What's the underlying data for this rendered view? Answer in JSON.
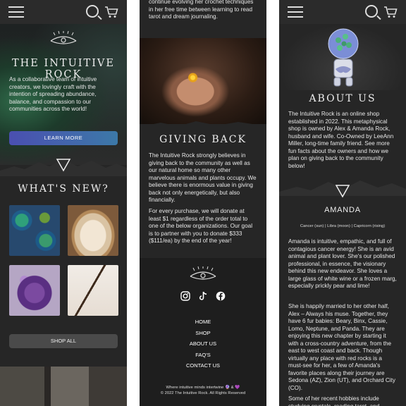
{
  "screen1": {
    "brand_title": "THE INTUITIVE ROCK",
    "intro": "As a collaborative team of intuitive creators, we lovingly craft with the intention of spreading abundance, balance, and compassion to our communities across the world!",
    "learn_more": "LEARN MORE",
    "whats_new_title": "WHAT'S NEW?",
    "shop_all": "SHOP ALL"
  },
  "screen2": {
    "top_text": "continue evolving her crochet techniques in her free time between learning to read tarot and dream journaling.",
    "giving_back_title": "GIVING BACK",
    "giving_back_p1": "The Intuitive Rock strongly believes in giving back to the community as well as our natural home so many other marvelous animals and plants occupy. We believe there is enormous value in giving back not only energetically, but also financially.",
    "giving_back_p2": "For every purchase, we will donate at least $1 regardless of the order total to one of the below organizations. Our goal is to partner with you to donate $333 ($111/ea) by the end of the year!",
    "footer_links": [
      "HOME",
      "SHOP",
      "ABOUT US",
      "FAQ'S",
      "CONTACT US"
    ],
    "tagline": "Where intuitive minds intertwine 🔮 & 💜",
    "copyright": "© 2022 The Intuitive Rock. All Rights Reserved"
  },
  "screen3": {
    "about_title": "ABOUT US",
    "about_text": "The Intuitive Rock is an online shop established in 2022. This metaphysical shop is owned by Alex & Amanda Rock, husband and wife. Co-Owned by LeeAnn Miller, long-time family friend. See more fun facts about the owners and how we plan on giving back to the community below!",
    "person_name": "AMANDA",
    "signs": "Cancer (sun) | Libra (moon) | Capricorn (rising)",
    "bio_p1": "Amanda is intuitive, empathic, and full of contagious cancer energy! She is an avid animal and plant lover. She's our polished professional, in essence, the visionary behind this new endeavor. She loves a large glass of white wine or a frozen marg, especially prickly pear and lime!",
    "bio_p2": "She is happily married to her other half, Alex – Always his muse. Together, they have 6 fur babies: Beary, Binx, Cassie, Lomo, Neptune, and Panda. They are enjoying this new chapter by starting it with a cross-country adventure, from the east to west coast and back. Though virtually any place with red rocks is a must-see for her, a few of Amanda's favorite places along their journey are Sedona (AZ), Zion (UT), and Orchard City (CO).",
    "bio_p3": "Some of her recent hobbies include studying crystals, reading tarot, and"
  }
}
